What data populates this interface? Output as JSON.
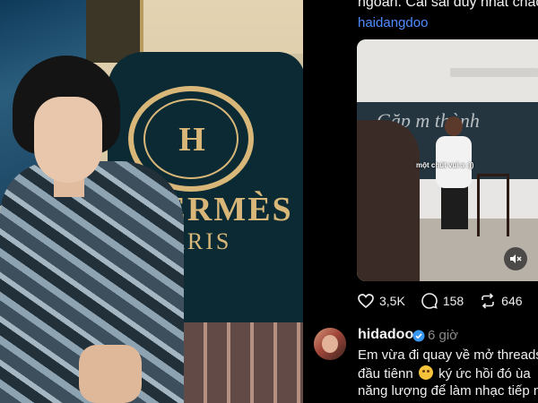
{
  "photo": {
    "brand_text": "HERMÈS",
    "brand_sub": "PARIS",
    "seal_letter": "H"
  },
  "post": {
    "text_line": "ngoan. Cái sai duy nhất chắc",
    "mention": "haidangdoo",
    "video": {
      "board_text": "Gặp m   thành",
      "caption": "một chút vui a :))"
    },
    "stats": {
      "likes": "3,5K",
      "comments": "158",
      "reposts": "646"
    }
  },
  "reply": {
    "username": "hidadoo",
    "time": "6 giờ",
    "line1": "Em vừa đi quay về mở threads",
    "line2_a": "đầu tiênn",
    "line2_b": "ký ức hồi đó ùa",
    "line3": "năng lượng để làm nhạc tiếp n"
  },
  "colors": {
    "background": "#000000",
    "mention": "#4f8cff",
    "verified": "#3897f0",
    "muted_text": "#8a8a8a"
  }
}
